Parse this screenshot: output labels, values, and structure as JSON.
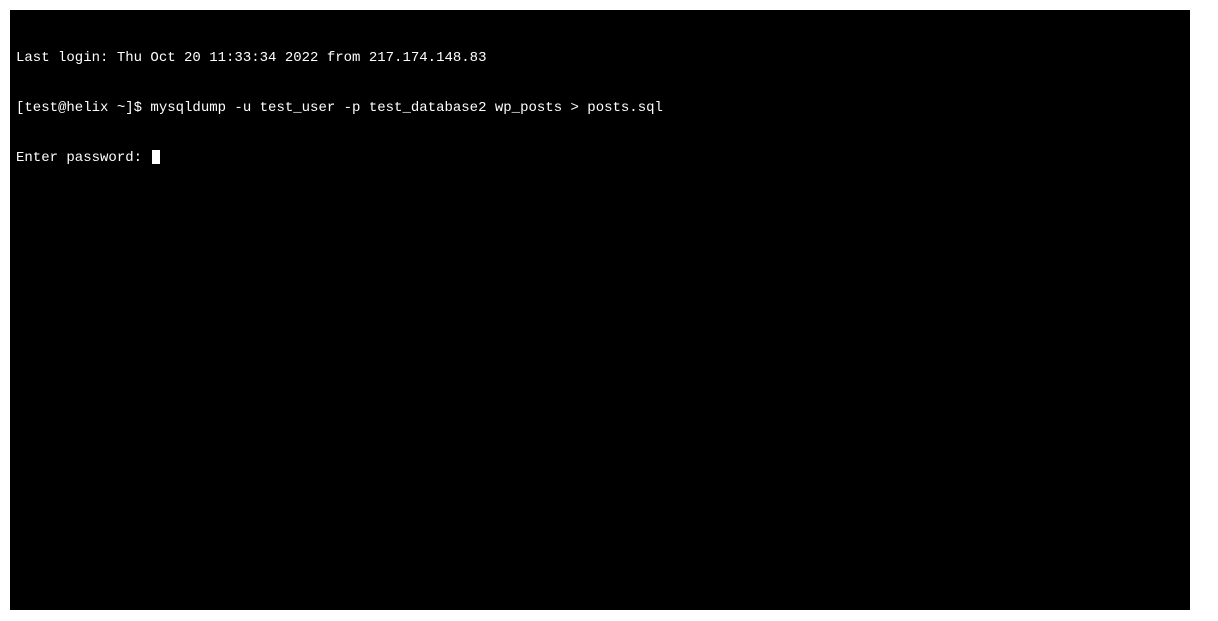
{
  "terminal": {
    "last_login": "Last login: Thu Oct 20 11:33:34 2022 from 217.174.148.83",
    "prompt": "[test@helix ~]$ ",
    "command": "mysqldump -u test_user -p test_database2 wp_posts > posts.sql",
    "password_prompt": "Enter password: "
  }
}
